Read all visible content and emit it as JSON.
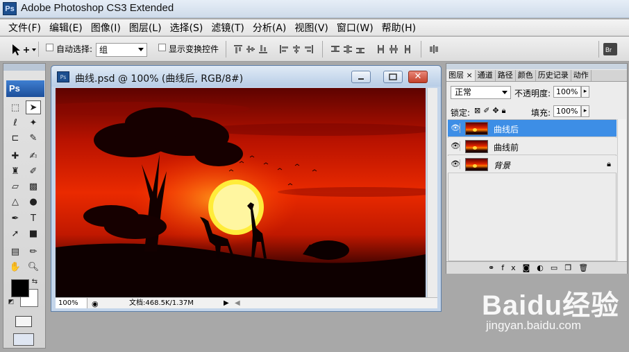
{
  "app": {
    "logo": "Ps",
    "title": "Adobe Photoshop CS3 Extended"
  },
  "menu": [
    "文件(F)",
    "编辑(E)",
    "图像(I)",
    "图层(L)",
    "选择(S)",
    "滤镜(T)",
    "分析(A)",
    "视图(V)",
    "窗口(W)",
    "帮助(H)"
  ],
  "options": {
    "auto_select_label": "自动选择:",
    "auto_select_value": "组",
    "show_transform_label": "显示变换控件"
  },
  "toolbox": {
    "logo": "Ps"
  },
  "document": {
    "title": "曲线.psd @ 100% (曲线后, RGB/8#)",
    "zoom": "100%",
    "info": "文档:468.5K/1.37M"
  },
  "layers_panel": {
    "tabs": [
      "图层 ×",
      "通道",
      "路径",
      "颜色",
      "历史记录",
      "动作"
    ],
    "blend_mode": "正常",
    "opacity_label": "不透明度:",
    "opacity_value": "100%",
    "lock_label": "锁定:",
    "fill_label": "填充:",
    "fill_value": "100%",
    "layers": [
      {
        "name": "曲线后",
        "selected": true,
        "locked": false
      },
      {
        "name": "曲线前",
        "selected": false,
        "locked": false
      },
      {
        "name": "背景",
        "selected": false,
        "locked": true
      }
    ]
  },
  "watermark": {
    "logo": "Baidu经验",
    "url": "jingyan.baidu.com"
  },
  "colors": {
    "title_bar": "#cfdbea",
    "selected_layer": "#3d8ee6",
    "sky_red": "#d81e00",
    "sun": "#ffec3a"
  }
}
